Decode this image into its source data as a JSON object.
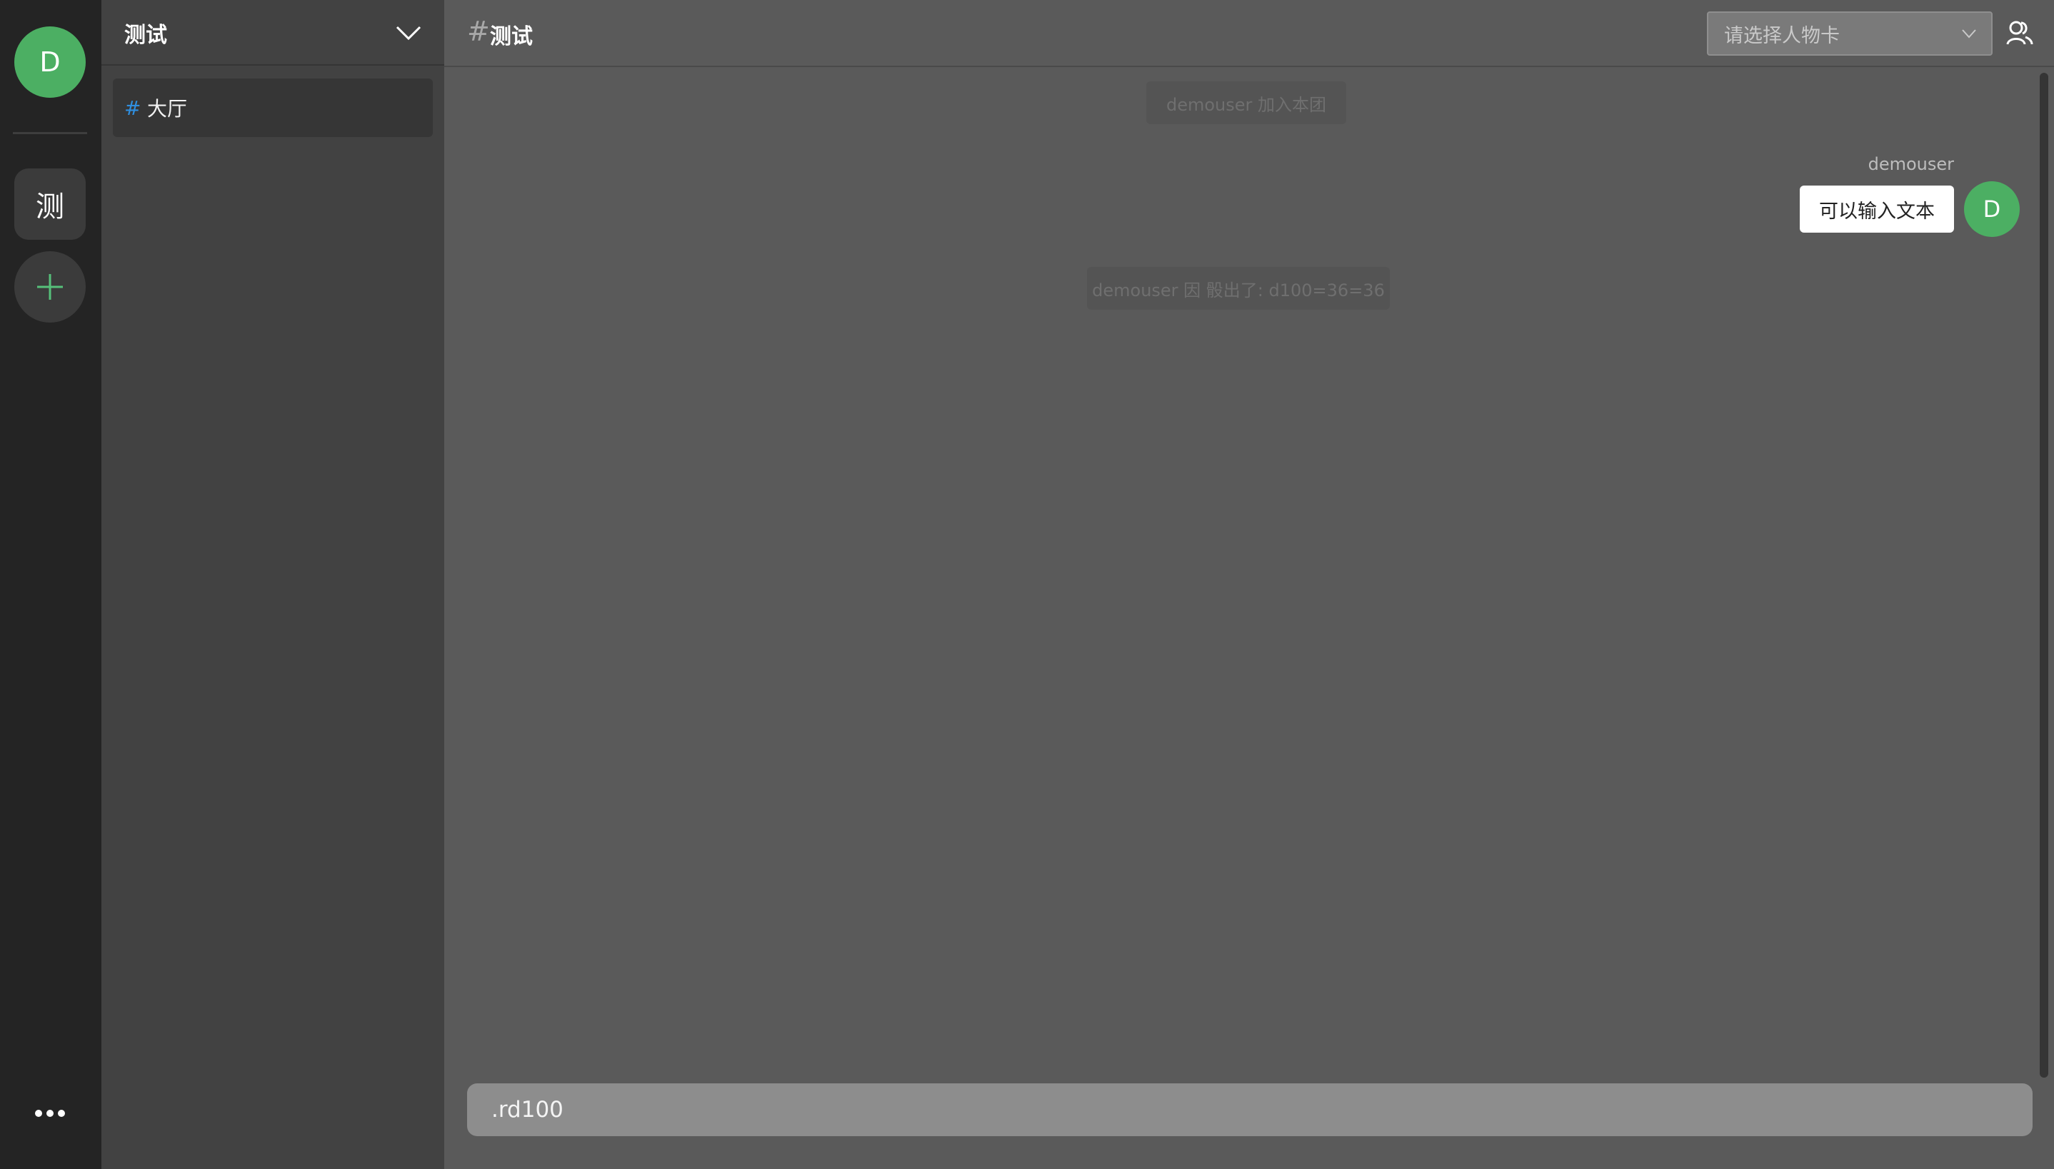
{
  "rail": {
    "user_avatar_letter": "D",
    "group_short": "测",
    "add_icon": "plus-icon",
    "more_icon": "ellipsis-icon"
  },
  "channels": {
    "group_title": "测试",
    "items": [
      {
        "hash": "#",
        "label": "大厅",
        "active": true
      }
    ]
  },
  "header": {
    "hash": "#",
    "title": "测试",
    "card_select": {
      "placeholder": "请选择人物卡",
      "selected": null
    },
    "members_icon": "members-icon"
  },
  "messages": [
    {
      "type": "system",
      "text": "demouser 加入本团"
    },
    {
      "type": "user",
      "sender": "demouser",
      "avatar_letter": "D",
      "text": "可以输入文本"
    },
    {
      "type": "system",
      "text": "demouser 因 骰出了: d100=36=36"
    }
  ],
  "composer": {
    "value": ".rd100"
  },
  "colors": {
    "accent_green": "#4caf63",
    "hash_blue": "#2f8fe0",
    "rail_bg": "#242424",
    "channels_bg": "#424242",
    "main_bg": "#5a5a5a"
  }
}
